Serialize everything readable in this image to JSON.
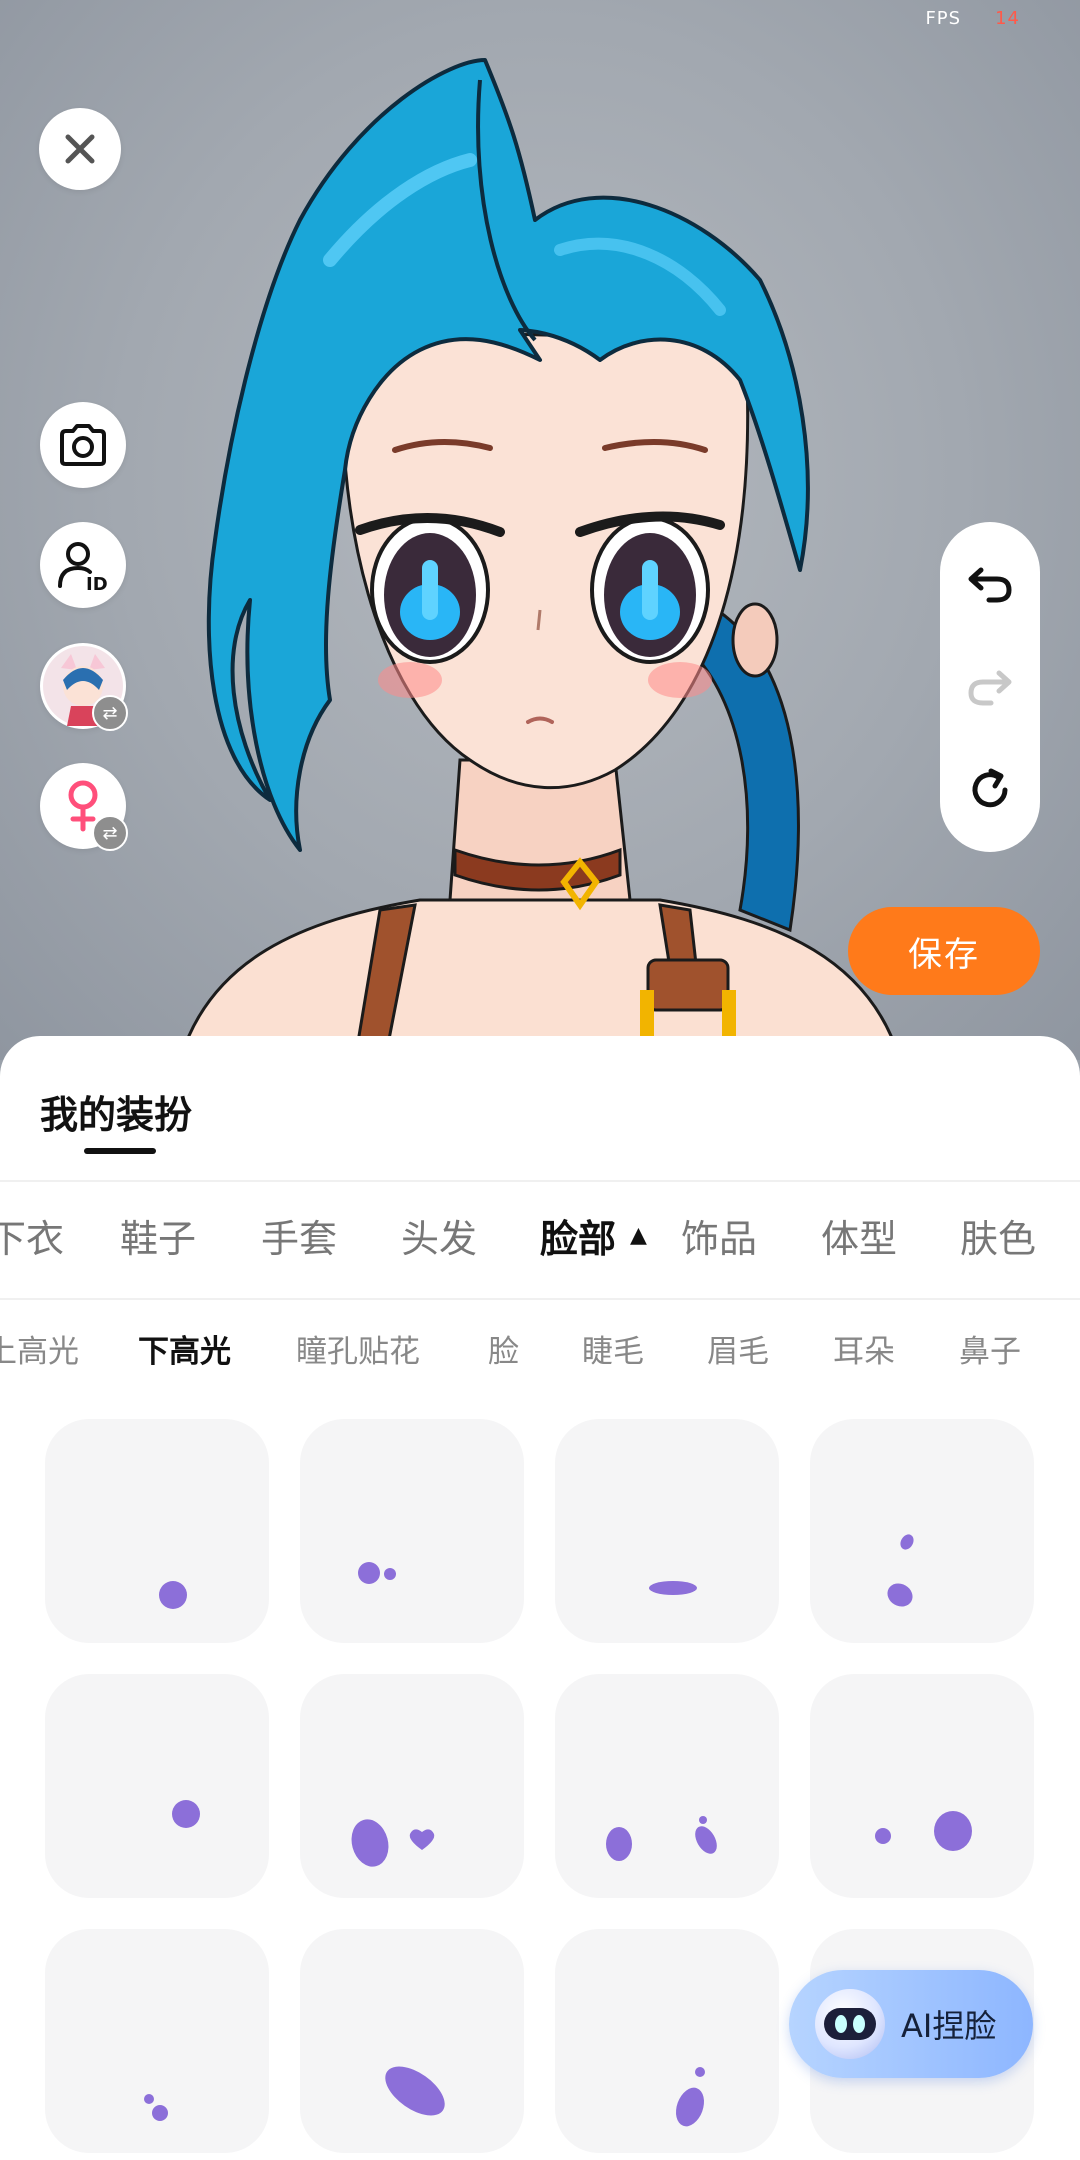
{
  "status": {
    "fps_label": "FPS",
    "fps_value": "14"
  },
  "actions": {
    "save_label": "保存",
    "ai_face_label": "AI捏脸"
  },
  "sheet": {
    "title": "我的装扮"
  },
  "categories": [
    {
      "label": "下衣",
      "active": false
    },
    {
      "label": "鞋子",
      "active": false
    },
    {
      "label": "手套",
      "active": false
    },
    {
      "label": "头发",
      "active": false
    },
    {
      "label": "脸部",
      "active": true
    },
    {
      "label": "饰品",
      "active": false
    },
    {
      "label": "体型",
      "active": false
    },
    {
      "label": "肤色",
      "active": false
    }
  ],
  "subcategories": [
    {
      "label": "上高光",
      "active": false
    },
    {
      "label": "下高光",
      "active": true
    },
    {
      "label": "瞳孔贴花",
      "active": false
    },
    {
      "label": "脸",
      "active": false
    },
    {
      "label": "睫毛",
      "active": false
    },
    {
      "label": "眉毛",
      "active": false
    },
    {
      "label": "耳朵",
      "active": false
    },
    {
      "label": "鼻子",
      "active": false
    }
  ],
  "colors": {
    "accent": "#ff7a1a",
    "highlight_swatch": "#8c6fd9",
    "hair": "#1aa6d8"
  },
  "icons": [
    "close-icon",
    "camera-icon",
    "user-id-icon",
    "avatar-thumbnail",
    "female-icon",
    "swap-icon",
    "undo-icon",
    "redo-icon",
    "reset-icon",
    "ai-robot-icon"
  ]
}
